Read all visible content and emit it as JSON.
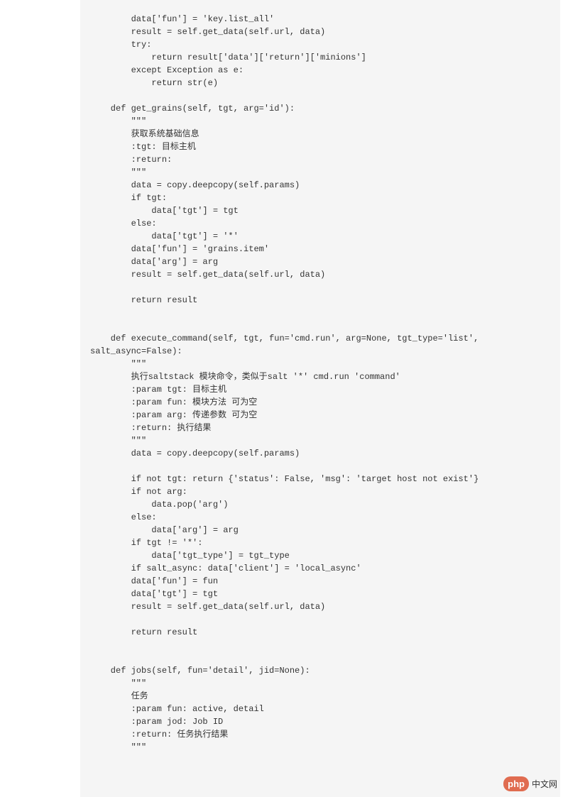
{
  "code": "        data['fun'] = 'key.list_all'\n        result = self.get_data(self.url, data)\n        try:\n            return result['data']['return']['minions']\n        except Exception as e:\n            return str(e)\n\n    def get_grains(self, tgt, arg='id'):\n        \"\"\"\n        获取系统基础信息\n        :tgt: 目标主机\n        :return:\n        \"\"\"\n        data = copy.deepcopy(self.params)\n        if tgt:\n            data['tgt'] = tgt\n        else:\n            data['tgt'] = '*'\n        data['fun'] = 'grains.item'\n        data['arg'] = arg\n        result = self.get_data(self.url, data)\n\n        return result\n\n\n    def execute_command(self, tgt, fun='cmd.run', arg=None, tgt_type='list',\nsalt_async=False):\n        \"\"\"\n        执行saltstack 模块命令，类似于salt '*' cmd.run 'command'\n        :param tgt: 目标主机\n        :param fun: 模块方法 可为空\n        :param arg: 传递参数 可为空\n        :return: 执行结果\n        \"\"\"\n        data = copy.deepcopy(self.params)\n\n        if not tgt: return {'status': False, 'msg': 'target host not exist'}\n        if not arg:\n            data.pop('arg')\n        else:\n            data['arg'] = arg\n        if tgt != '*':\n            data['tgt_type'] = tgt_type\n        if salt_async: data['client'] = 'local_async'\n        data['fun'] = fun\n        data['tgt'] = tgt\n        result = self.get_data(self.url, data)\n\n        return result\n\n\n    def jobs(self, fun='detail', jid=None):\n        \"\"\"\n        任务\n        :param fun: active, detail\n        :param jod: Job ID\n        :return: 任务执行结果\n        \"\"\"",
  "logo": {
    "badge": "php",
    "text": "中文网"
  }
}
